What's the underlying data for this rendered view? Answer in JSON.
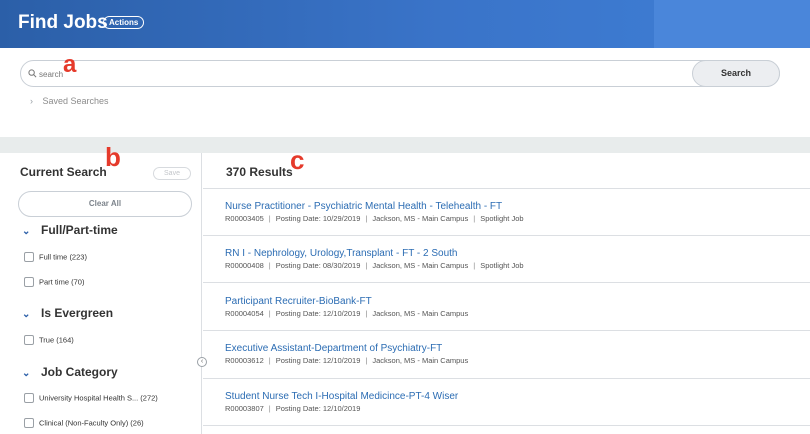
{
  "header": {
    "title": "Find Jobs",
    "actions_label": "Actions"
  },
  "search": {
    "placeholder": "search",
    "button_label": "Search",
    "saved_searches_label": "Saved Searches"
  },
  "annotations": {
    "a": "a",
    "b": "b",
    "c": "c"
  },
  "sidebar": {
    "title": "Current Search",
    "save_label": "Save",
    "clear_all_label": "Clear All",
    "facets": [
      {
        "label": "Full/Part-time",
        "options": [
          {
            "label": "Full time",
            "count": "(223)"
          },
          {
            "label": "Part time",
            "count": "(70)"
          }
        ]
      },
      {
        "label": "Is Evergreen",
        "options": [
          {
            "label": "True",
            "count": "(164)"
          }
        ]
      },
      {
        "label": "Job Category",
        "options": [
          {
            "label": "University Hospital Health S...",
            "count": "(272)"
          },
          {
            "label": "Clinical (Non-Faculty Only)",
            "count": "(26)"
          }
        ]
      }
    ]
  },
  "results": {
    "count_label": "370 Results",
    "items": [
      {
        "title": "Nurse Practitioner - Psychiatric Mental Health - Telehealth - FT",
        "id": "R00003405",
        "posting_date": "Posting Date: 10/29/2019",
        "location": "Jackson, MS - Main Campus",
        "tag": "Spotlight Job"
      },
      {
        "title": "RN I - Nephrology, Urology,Transplant - FT - 2 South",
        "id": "R00000408",
        "posting_date": "Posting Date: 08/30/2019",
        "location": "Jackson, MS - Main Campus",
        "tag": "Spotlight Job"
      },
      {
        "title": "Participant Recruiter-BioBank-FT",
        "id": "R00004054",
        "posting_date": "Posting Date: 12/10/2019",
        "location": "Jackson, MS - Main Campus",
        "tag": ""
      },
      {
        "title": "Executive Assistant-Department of Psychiatry-FT",
        "id": "R00003612",
        "posting_date": "Posting Date: 12/10/2019",
        "location": "Jackson, MS - Main Campus",
        "tag": ""
      },
      {
        "title": "Student Nurse Tech I-Hospital Medicince-PT-4 Wiser",
        "id": "R00003807",
        "posting_date": "Posting Date: 12/10/2019",
        "location": "",
        "tag": ""
      }
    ]
  },
  "colors": {
    "brand_blue": "#2b5fa8",
    "link_blue": "#2b6cb3",
    "annotation_red": "#e53a2b"
  }
}
